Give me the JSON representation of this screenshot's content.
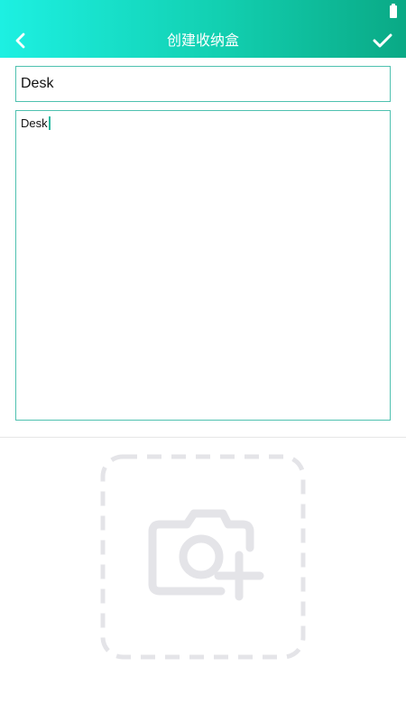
{
  "header": {
    "title": "创建收纳盒",
    "back_icon": "chevron-left-icon",
    "confirm_icon": "checkmark-icon",
    "gradient_colors": [
      "#1df0e2",
      "#0aa985"
    ]
  },
  "status_bar": {
    "battery_icon": "battery-icon"
  },
  "form": {
    "name_value": "Desk",
    "description_value": "Desk",
    "border_color": "#4fc1b0"
  },
  "photo": {
    "icon": "camera-add-icon",
    "placeholder_color": "#e4e4e8"
  }
}
